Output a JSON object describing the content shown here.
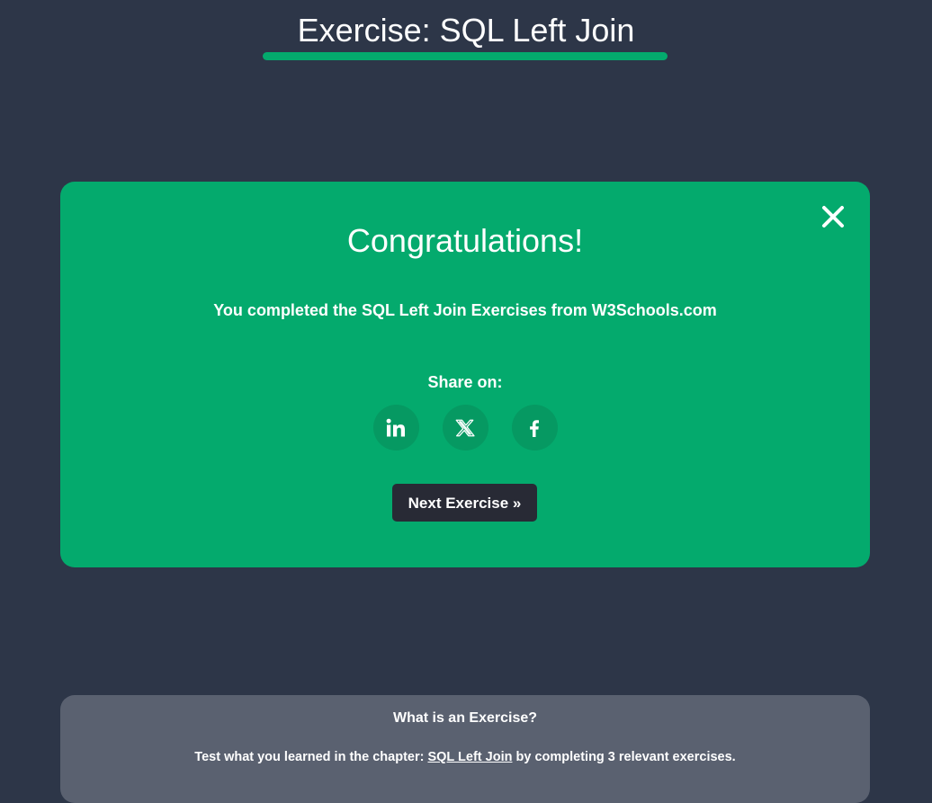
{
  "header": {
    "title": "Exercise: SQL Left Join"
  },
  "congrats": {
    "heading": "Congratulations!",
    "message": "You completed the SQL Left Join Exercises from W3Schools.com",
    "share_label": "Share on:",
    "share_buttons": [
      {
        "icon": "linkedin-icon"
      },
      {
        "icon": "x-icon"
      },
      {
        "icon": "facebook-icon"
      }
    ],
    "next_button": "Next Exercise »",
    "close_icon": "close-icon"
  },
  "info": {
    "title": "What is an Exercise?",
    "text_before": "Test what you learned in the chapter: ",
    "link": "SQL Left Join",
    "text_after": " by completing 3 relevant exercises."
  },
  "colors": {
    "background": "#2d3648",
    "accent": "#04aa6d",
    "share_button": "#069962",
    "dark_button": "#282a35",
    "info_card": "#5a6170"
  }
}
